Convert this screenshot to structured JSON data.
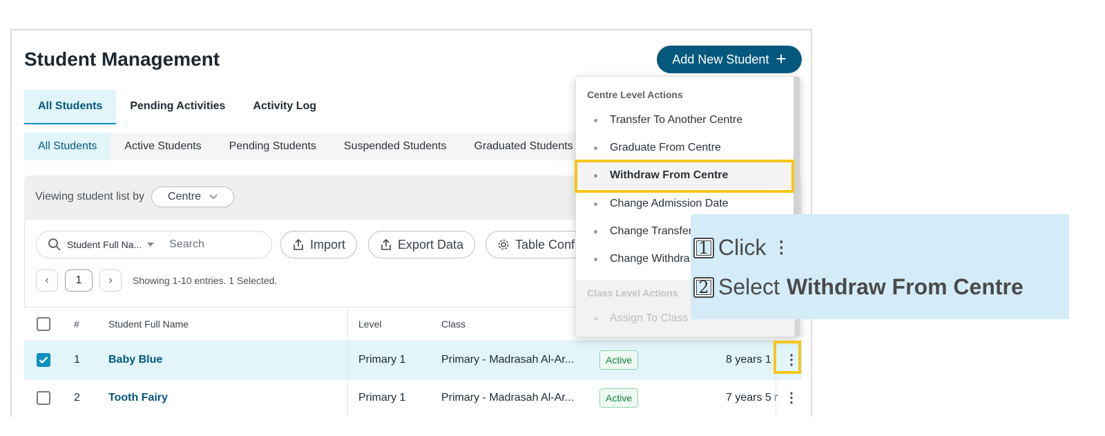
{
  "header": {
    "title": "Student Management",
    "add_button": "Add New Student"
  },
  "tabs": [
    {
      "label": "All Students"
    },
    {
      "label": "Pending Activities"
    },
    {
      "label": "Activity Log"
    }
  ],
  "subtabs": [
    {
      "label": "All Students"
    },
    {
      "label": "Active Students"
    },
    {
      "label": "Pending Students"
    },
    {
      "label": "Suspended Students"
    },
    {
      "label": "Graduated Students"
    }
  ],
  "view": {
    "label": "Viewing student list by",
    "selected": "Centre"
  },
  "toolbar": {
    "search_field": "Student Full Na...",
    "search_placeholder": "Search",
    "import_label": "Import",
    "export_label": "Export Data",
    "config_label": "Table Conf"
  },
  "pagination": {
    "page": "1",
    "showing": "Showing 1-10 entries. 1 Selected."
  },
  "table": {
    "headers": {
      "num": "#",
      "name": "Student Full Name",
      "level": "Level",
      "class": "Class"
    },
    "rows": [
      {
        "num": "1",
        "name": "Baby Blue",
        "level": "Primary 1",
        "class": "Primary - Madrasah Al-Ar...",
        "status": "Active",
        "age": "8 years 1",
        "checked": true
      },
      {
        "num": "2",
        "name": "Tooth Fairy",
        "level": "Primary 1",
        "class": "Primary - Madrasah Al-Ar...",
        "status": "Active",
        "age": "7 years 5 r",
        "checked": false
      }
    ]
  },
  "menu": {
    "centre_heading": "Centre Level Actions",
    "centre_items": [
      {
        "label": "Transfer To Another Centre"
      },
      {
        "label": "Graduate From Centre"
      },
      {
        "label": "Withdraw From Centre"
      },
      {
        "label": "Change Admission Date"
      },
      {
        "label": "Change Transfer"
      },
      {
        "label": "Change Withdra"
      }
    ],
    "class_heading": "Class Level Actions",
    "class_items": [
      {
        "label": "Assign To Class"
      }
    ]
  },
  "callout": {
    "step1_num": "1",
    "step1_text": "Click",
    "step1_icon": "⋮",
    "step2_num": "2",
    "step2_text": "Select",
    "step2_bold": "Withdraw From Centre"
  },
  "colors": {
    "primary": "#04587e",
    "accent": "#0d8fbf",
    "highlight": "#f6c619",
    "callout_bg": "#d4ecf8",
    "active_badge": "#12813b"
  }
}
